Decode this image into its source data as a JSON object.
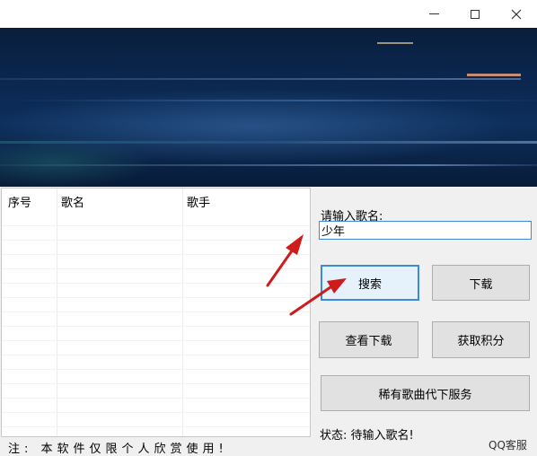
{
  "window": {
    "controls": {
      "minimize": "minimize-icon",
      "maximize": "maximize-icon",
      "close": "close-icon"
    }
  },
  "results": {
    "columns": [
      "序号",
      "歌名",
      "歌手"
    ],
    "rows": []
  },
  "search": {
    "label": "请输入歌名:",
    "value": "少年"
  },
  "buttons": {
    "search": "搜索",
    "download": "下载",
    "view_downloads": "查看下载",
    "get_points": "获取积分",
    "rare_song_service": "稀有歌曲代下服务"
  },
  "status": "状态: 待输入歌名!",
  "support": "QQ客服",
  "note": "注: 本软件仅限个人欣赏使用!",
  "colors": {
    "annotation_arrow": "#d01b1b",
    "focus_border": "#3c8ad8"
  }
}
